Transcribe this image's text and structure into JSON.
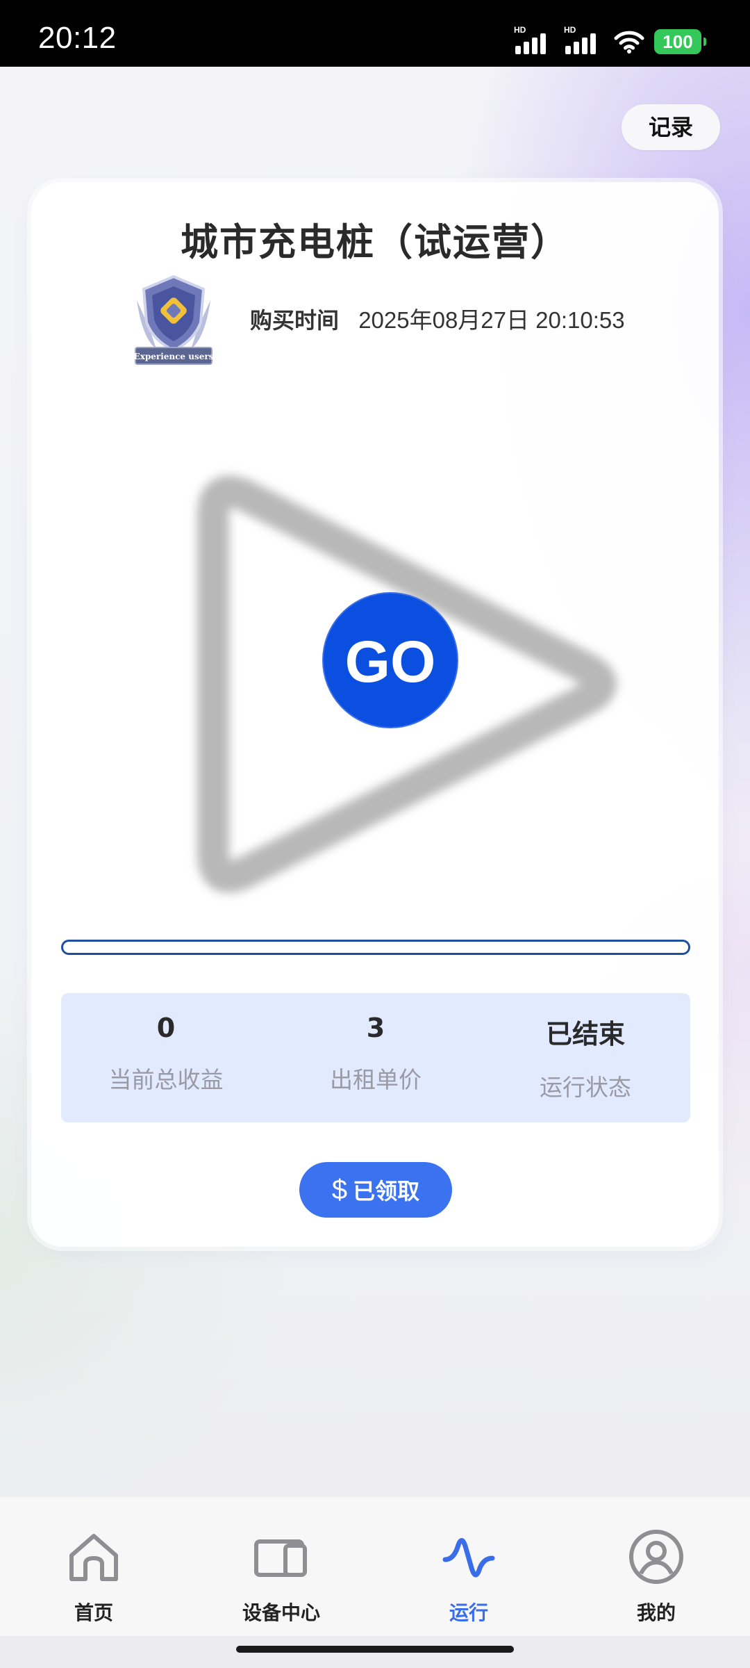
{
  "status_bar": {
    "time": "20:12",
    "network_1": "HD",
    "network_2": "HD",
    "battery": "100"
  },
  "header": {
    "record_label": "记录"
  },
  "card": {
    "title": "城市充电桩（试运营）",
    "badge_text": "Experience users",
    "buy_label": "购买时间",
    "buy_time": "2025年08月27日 20:10:53",
    "go_label": "GO",
    "progress": 0,
    "stats": [
      {
        "value": "0",
        "label": "当前总收益"
      },
      {
        "value": "3",
        "label": "出租单价"
      },
      {
        "value": "已结束",
        "label": "运行状态"
      }
    ],
    "claim_icon": "$",
    "claim_label": "已领取"
  },
  "tabbar": {
    "items": [
      {
        "label": "首页",
        "icon": "home-icon",
        "active": false
      },
      {
        "label": "设备中心",
        "icon": "devices-icon",
        "active": false
      },
      {
        "label": "运行",
        "icon": "wave-icon",
        "active": true
      },
      {
        "label": "我的",
        "icon": "user-icon",
        "active": false
      }
    ]
  },
  "colors": {
    "accent": "#0b4fe0",
    "button": "#3a72f0",
    "progress": "#1d4f9e",
    "tab_active": "#3a6ee8",
    "stats_bg": "#e1eaff"
  }
}
